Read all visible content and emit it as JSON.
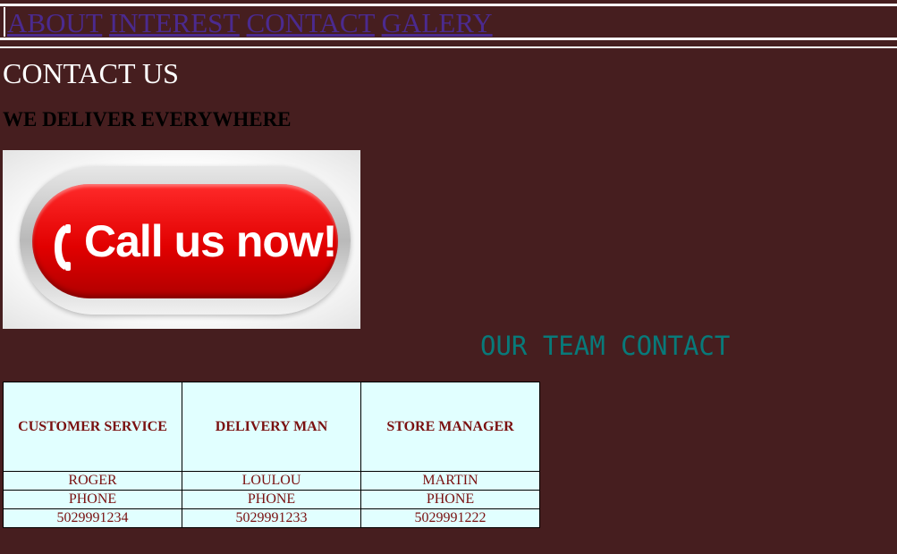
{
  "nav": {
    "links": [
      "ABOUT",
      "INTEREST",
      "CONTACT",
      "GALERY"
    ]
  },
  "page": {
    "title": "CONTACT US",
    "subtitle": "WE DELIVER EVERYWHERE"
  },
  "banner": {
    "text": "Call us now!",
    "icon": "phone-icon"
  },
  "team": {
    "heading": "OUR TEAM CONTACT",
    "headers": [
      "CUSTOMER SERVICE",
      "DELIVERY MAN",
      "STORE MANAGER"
    ],
    "names": [
      "ROGER",
      "LOULOU",
      "MARTIN"
    ],
    "labels": [
      "PHONE",
      "PHONE",
      "PHONE"
    ],
    "phones": [
      "5029991234",
      "5029991233",
      "5029991222"
    ]
  },
  "colors": {
    "background": "#461e1f",
    "link": "#4b2a8f",
    "heading_accent": "#087a7a",
    "table_background": "#e1ffff",
    "table_text": "#7a1010"
  }
}
